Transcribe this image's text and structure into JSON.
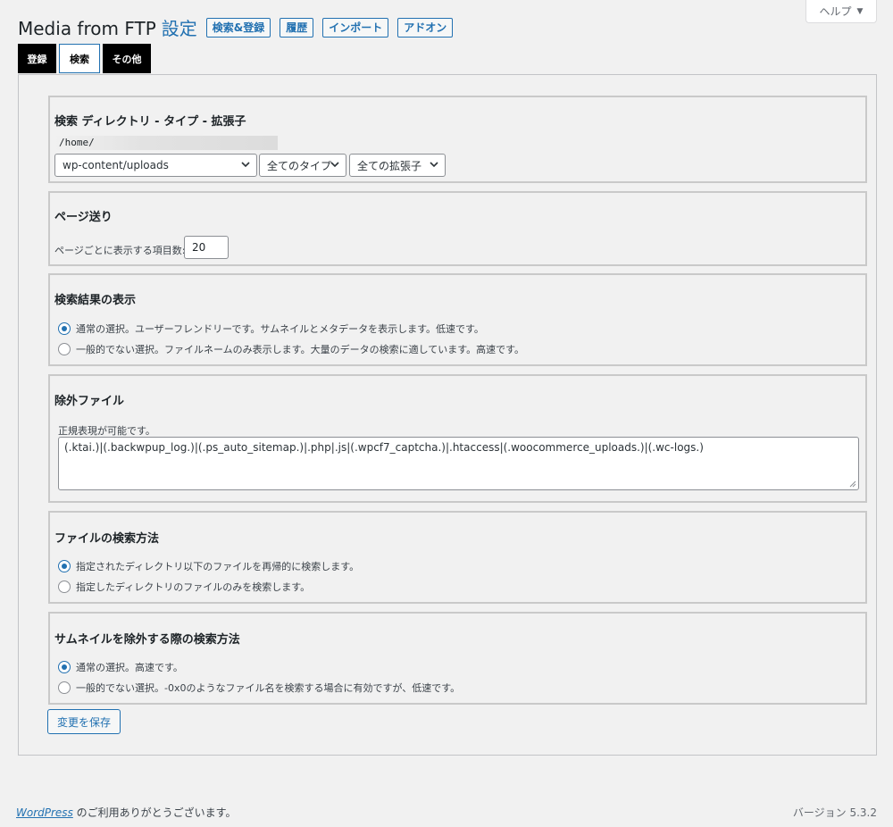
{
  "help": {
    "label": "ヘルプ"
  },
  "header": {
    "title": "Media from FTP",
    "settings": "設定",
    "buttons": [
      "検索&登録",
      "履歴",
      "インポート",
      "アドオン"
    ]
  },
  "tabs": [
    "登録",
    "検索",
    "その他"
  ],
  "sections": {
    "directory": {
      "title": "検索 ディレクトリ - タイプ - 拡張子",
      "path": "/home/",
      "dir_select": "wp-content/uploads",
      "type_select": "全てのタイプ",
      "ext_select": "全ての拡張子"
    },
    "pagination": {
      "title": "ページ送り",
      "label": "ページごとに表示する項目数:",
      "value": "20"
    },
    "display": {
      "title": "検索結果の表示",
      "options": [
        "通常の選択。ユーザーフレンドリーです。サムネイルとメタデータを表示します。低速です。",
        "一般的でない選択。ファイルネームのみ表示します。大量のデータの検索に適しています。高速です。"
      ]
    },
    "exclude": {
      "title": "除外ファイル",
      "note": "正規表現が可能です。",
      "value": "(.ktai.)|(.backwpup_log.)|(.ps_auto_sitemap.)|.php|.js|(.wpcf7_captcha.)|.htaccess|(.woocommerce_uploads.)|(.wc-logs.)"
    },
    "search_method": {
      "title": "ファイルの検索方法",
      "options": [
        "指定されたディレクトリ以下のファイルを再帰的に検索します。",
        "指定したディレクトリのファイルのみを検索します。"
      ]
    },
    "thumb_method": {
      "title": "サムネイルを除外する際の検索方法",
      "options": [
        "通常の選択。高速です。",
        "一般的でない選択。-0x0のようなファイル名を検索する場合に有効ですが、低速です。"
      ]
    }
  },
  "save_label": "変更を保存",
  "footer": {
    "wp_link": "WordPress",
    "thanks": " のご利用ありがとうございます。",
    "version": "バージョン 5.3.2"
  },
  "colors": {
    "accent": "#2271b1",
    "tab_dark": "#000000"
  }
}
